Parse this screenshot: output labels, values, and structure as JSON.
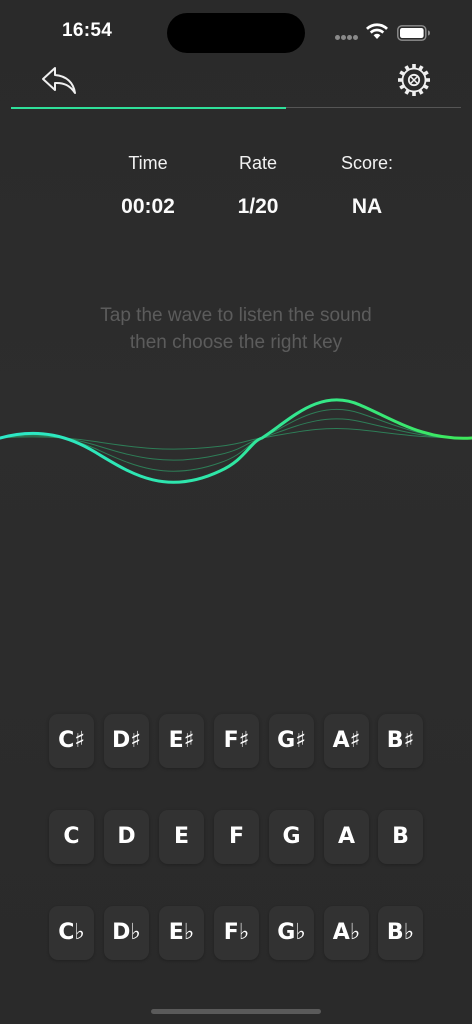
{
  "status": {
    "time": "16:54"
  },
  "progress": {
    "fraction": 0.611
  },
  "stats": [
    {
      "label": "Time",
      "value": "00:02"
    },
    {
      "label": "Rate",
      "value": "1/20"
    },
    {
      "label": "Score:",
      "value": "NA"
    }
  ],
  "hint": {
    "line1": "Tap the wave to listen the sound",
    "line2": "then choose the right key"
  },
  "keys": {
    "sharps": [
      "C♯",
      "D♯",
      "E♯",
      "F♯",
      "G♯",
      "A♯",
      "B♯"
    ],
    "naturals": [
      "C",
      "D",
      "E",
      "F",
      "G",
      "A",
      "B"
    ],
    "flats": [
      "C♭",
      "D♭",
      "E♭",
      "F♭",
      "G♭",
      "A♭",
      "B♭"
    ]
  },
  "colors": {
    "accent_green": "#2fe09a",
    "wave_cyan": "#2de8c8",
    "wave_green": "#3ee85a",
    "key_bg": "#323232"
  },
  "icons": {
    "back": "reply-arrow-icon",
    "settings": "gear-icon",
    "wifi": "wifi-icon",
    "battery": "battery-icon"
  }
}
